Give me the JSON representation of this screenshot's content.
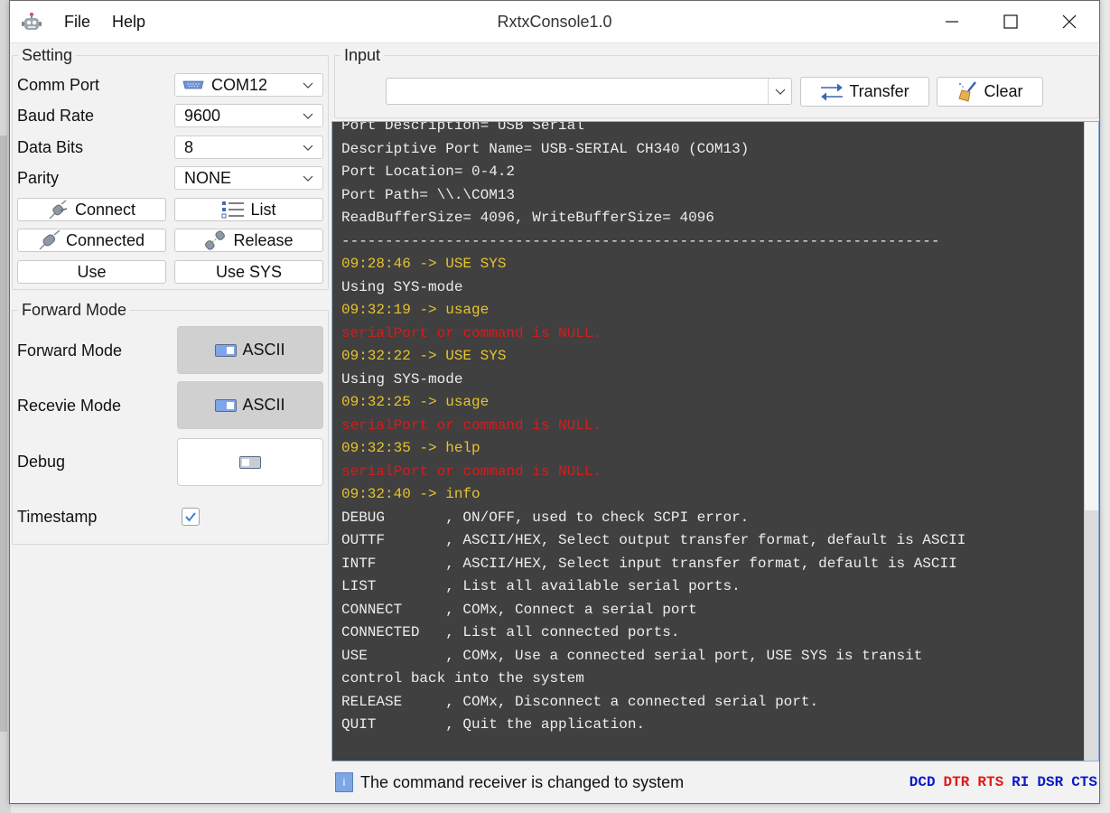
{
  "window": {
    "title": "RxtxConsole1.0",
    "menu": [
      "File",
      "Help"
    ]
  },
  "setting": {
    "legend": "Setting",
    "rows": [
      {
        "label": "Comm Port",
        "value": "COM12",
        "icon": "serial-port-icon"
      },
      {
        "label": "Baud Rate",
        "value": "9600"
      },
      {
        "label": "Data Bits",
        "value": "8"
      },
      {
        "label": "Parity",
        "value": "NONE"
      }
    ],
    "buttons": {
      "connect": "Connect",
      "list": "List",
      "connected": "Connected",
      "release": "Release",
      "use": "Use",
      "use_sys": "Use SYS"
    }
  },
  "forward": {
    "legend": "Forward Mode",
    "forward_mode": {
      "label": "Forward Mode",
      "value": "ASCII",
      "on": true
    },
    "receive_mode": {
      "label": "Recevie Mode",
      "value": "ASCII",
      "on": true
    },
    "debug": {
      "label": "Debug",
      "value": "",
      "on": false
    },
    "timestamp": {
      "label": "Timestamp",
      "checked": true
    }
  },
  "input": {
    "legend": "Input",
    "value": "",
    "transfer_label": "Transfer",
    "clear_label": "Clear"
  },
  "console": {
    "lines": [
      {
        "text": "Port Description= USB Serial",
        "color": "white"
      },
      {
        "text": "Descriptive Port Name= USB-SERIAL CH340 (COM13)",
        "color": "white"
      },
      {
        "text": "Port Location= 0-4.2",
        "color": "white"
      },
      {
        "text": "Port Path= \\\\.\\COM13",
        "color": "white"
      },
      {
        "text": "ReadBufferSize= 4096, WriteBufferSize= 4096",
        "color": "white"
      },
      {
        "text": "---------------------------------------------------------------------",
        "color": "white"
      },
      {
        "text": "09:28:46 -> USE SYS",
        "color": "yellow"
      },
      {
        "text": "Using SYS-mode",
        "color": "white"
      },
      {
        "text": "09:32:19 -> usage",
        "color": "yellow"
      },
      {
        "text": "serialPort or command is NULL.",
        "color": "red"
      },
      {
        "text": "09:32:22 -> USE SYS",
        "color": "yellow"
      },
      {
        "text": "Using SYS-mode",
        "color": "white"
      },
      {
        "text": "09:32:25 -> usage",
        "color": "yellow"
      },
      {
        "text": "serialPort or command is NULL.",
        "color": "red"
      },
      {
        "text": "09:32:35 -> help",
        "color": "yellow"
      },
      {
        "text": "serialPort or command is NULL.",
        "color": "red"
      },
      {
        "text": "09:32:40 -> info",
        "color": "yellow"
      },
      {
        "text": "DEBUG       , ON/OFF, used to check SCPI error.",
        "color": "white"
      },
      {
        "text": "OUTTF       , ASCII/HEX, Select output transfer format, default is ASCII",
        "color": "white"
      },
      {
        "text": "INTF        , ASCII/HEX, Select input transfer format, default is ASCII",
        "color": "white"
      },
      {
        "text": "LIST        , List all available serial ports.",
        "color": "white"
      },
      {
        "text": "CONNECT     , COMx, Connect a serial port",
        "color": "white"
      },
      {
        "text": "CONNECTED   , List all connected ports.",
        "color": "white"
      },
      {
        "text": "USE         , COMx, Use a connected serial port, USE SYS is transit",
        "color": "white"
      },
      {
        "text": "control back into the system",
        "color": "white"
      },
      {
        "text": "RELEASE     , COMx, Disconnect a connected serial port.",
        "color": "white"
      },
      {
        "text": "QUIT        , Quit the application.",
        "color": "white"
      }
    ]
  },
  "status": {
    "message": "The command receiver is changed to system",
    "signals": [
      {
        "name": "DCD",
        "color": "#0a1acc"
      },
      {
        "name": "DTR",
        "color": "#e01a1a"
      },
      {
        "name": "RTS",
        "color": "#e01a1a"
      },
      {
        "name": "RI",
        "color": "#0a1acc"
      },
      {
        "name": "DSR",
        "color": "#0a1acc"
      },
      {
        "name": "CTS",
        "color": "#0a1acc"
      }
    ]
  }
}
